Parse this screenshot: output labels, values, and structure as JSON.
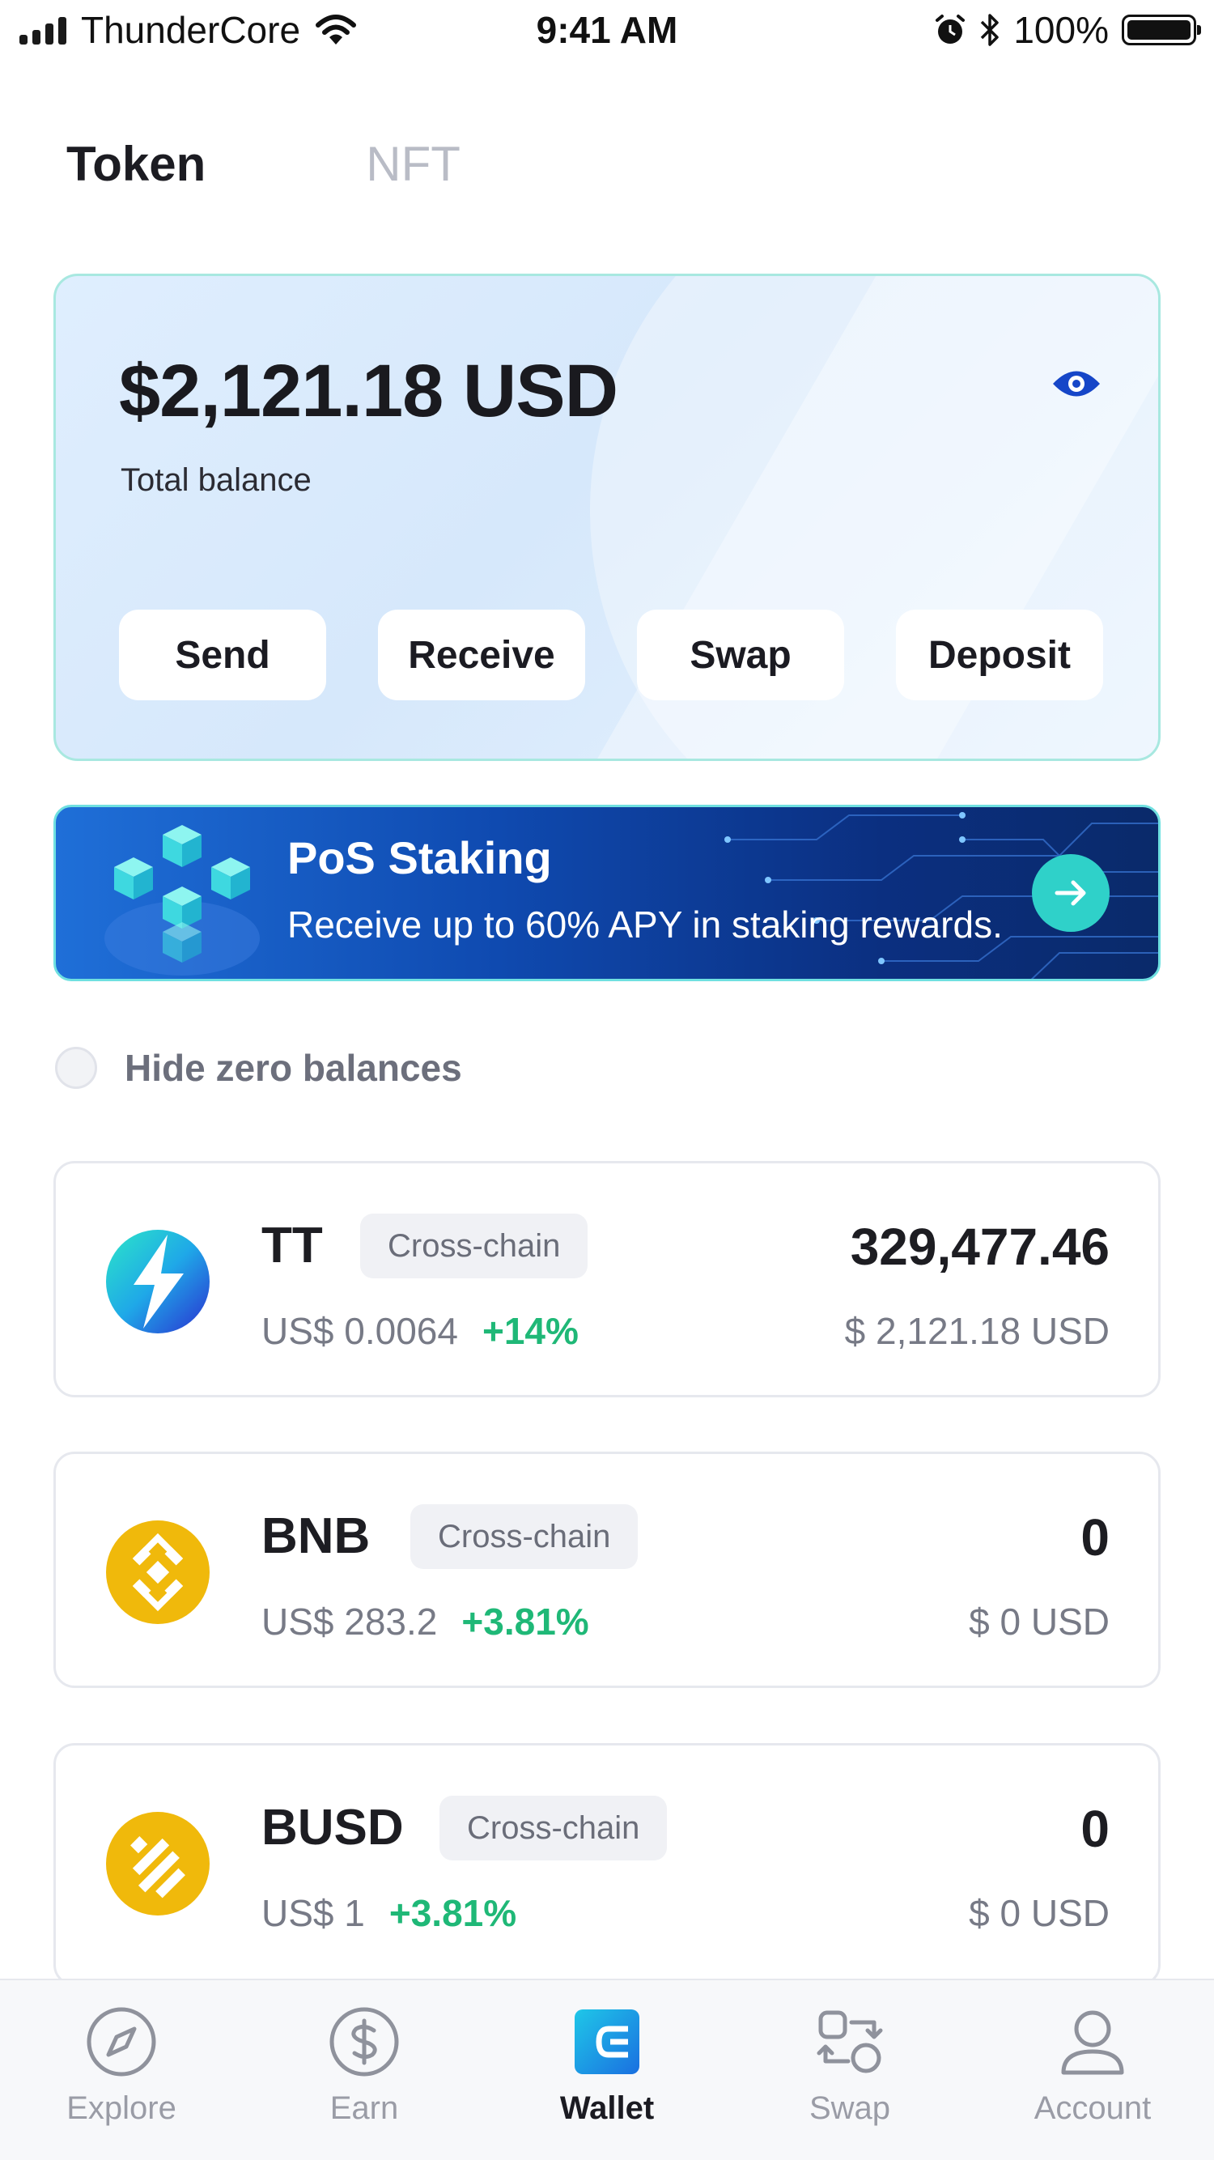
{
  "status_bar": {
    "carrier": "ThunderCore",
    "time": "9:41 AM",
    "battery": "100%",
    "icons": [
      "signal-icon",
      "wifi-icon",
      "alarm-icon",
      "bluetooth-icon",
      "battery-icon"
    ]
  },
  "tabs": [
    {
      "label": "Token",
      "active": true
    },
    {
      "label": "NFT",
      "active": false
    }
  ],
  "balance": {
    "amount": "$2,121.18 USD",
    "label": "Total balance",
    "visibility_icon": "eye-icon"
  },
  "actions": [
    {
      "label": "Send"
    },
    {
      "label": "Receive"
    },
    {
      "label": "Swap"
    },
    {
      "label": "Deposit"
    }
  ],
  "staking_banner": {
    "title": "PoS Staking",
    "description": "Receive up to 60% APY in staking rewards.",
    "arrow_icon": "arrow-right-icon"
  },
  "hide_zero": {
    "label": "Hide zero balances",
    "checked": false
  },
  "tokens": [
    {
      "symbol": "TT",
      "badge": "Cross-chain",
      "price": "US$ 0.0064",
      "change": "+14%",
      "amount": "329,477.46",
      "value": "$ 2,121.18 USD",
      "logo": "thundercore-logo-icon"
    },
    {
      "symbol": "BNB",
      "badge": "Cross-chain",
      "price": "US$ 283.2",
      "change": "+3.81%",
      "amount": "0",
      "value": "$ 0 USD",
      "logo": "bnb-logo-icon"
    },
    {
      "symbol": "BUSD",
      "badge": "Cross-chain",
      "price": "US$ 1",
      "change": "+3.81%",
      "amount": "0",
      "value": "$ 0 USD",
      "logo": "busd-logo-icon"
    }
  ],
  "bottom_nav": [
    {
      "label": "Explore",
      "icon": "compass-icon",
      "active": false
    },
    {
      "label": "Earn",
      "icon": "dollar-icon",
      "active": false
    },
    {
      "label": "Wallet",
      "icon": "wallet-icon",
      "active": true
    },
    {
      "label": "Swap",
      "icon": "swap-icon",
      "active": false
    },
    {
      "label": "Account",
      "icon": "user-icon",
      "active": false
    }
  ],
  "colors": {
    "positive_change": "#1fb877",
    "accent_blue": "#1646c8",
    "staking_arrow": "#2fd1c9",
    "inactive_tab": "#b9bcc6"
  }
}
